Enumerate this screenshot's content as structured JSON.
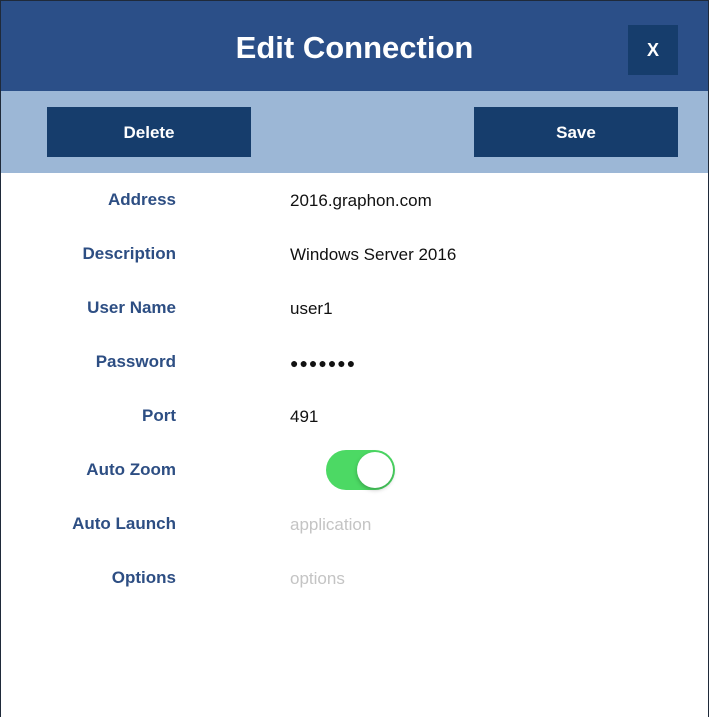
{
  "dialog": {
    "title": "Edit Connection",
    "close_label": "X"
  },
  "toolbar": {
    "delete_label": "Delete",
    "save_label": "Save"
  },
  "fields": {
    "address": {
      "label": "Address",
      "value": "2016.graphon.com"
    },
    "description": {
      "label": "Description",
      "value": "Windows Server 2016"
    },
    "user_name": {
      "label": "User Name",
      "value": "user1"
    },
    "password": {
      "label": "Password",
      "value": "●●●●●●●"
    },
    "port": {
      "label": "Port",
      "value": "491"
    },
    "auto_zoom": {
      "label": "Auto Zoom",
      "enabled": true
    },
    "auto_launch": {
      "label": "Auto Launch",
      "placeholder": "application"
    },
    "options": {
      "label": "Options",
      "placeholder": "options"
    }
  },
  "colors": {
    "titlebar": "#2b4f88",
    "toolbar": "#9cb7d6",
    "button": "#163d6c",
    "label": "#2d4e83",
    "toggle_on": "#4cd964"
  }
}
